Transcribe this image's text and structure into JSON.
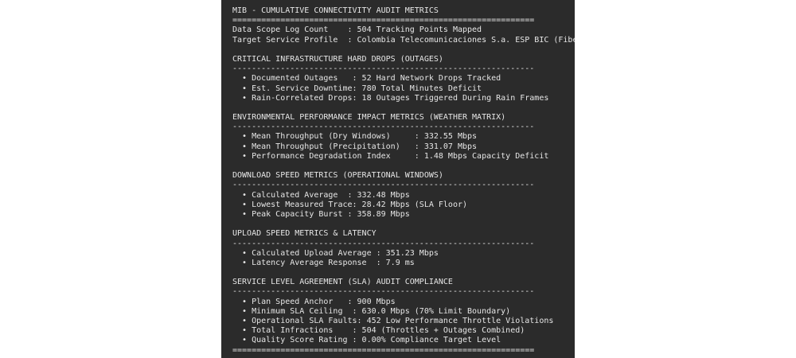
{
  "title": "MIB - CUMULATIVE CONNECTIVITY AUDIT METRICS",
  "rule_double": "===============================================================",
  "rule_single": "---------------------------------------------------------------",
  "header": {
    "scope": "Data Scope Log Count    : 504 Tracking Points Mapped",
    "profile": "Target Service Profile  : Colombia Telecomunicaciones S.a. ESP BIC (Fiber)"
  },
  "outages": {
    "heading": "CRITICAL INFRASTRUCTURE HARD DROPS (OUTAGES)",
    "items": [
      "  • Documented Outages   : 52 Hard Network Drops Tracked",
      "  • Est. Service Downtime: 780 Total Minutes Deficit",
      "  • Rain-Correlated Drops: 18 Outages Triggered During Rain Frames"
    ]
  },
  "weather": {
    "heading": "ENVIRONMENTAL PERFORMANCE IMPACT METRICS (WEATHER MATRIX)",
    "items": [
      "  • Mean Throughput (Dry Windows)     : 332.55 Mbps",
      "  • Mean Throughput (Precipitation)   : 331.07 Mbps",
      "  • Performance Degradation Index     : 1.48 Mbps Capacity Deficit"
    ]
  },
  "download": {
    "heading": "DOWNLOAD SPEED METRICS (OPERATIONAL WINDOWS)",
    "items": [
      "  • Calculated Average  : 332.48 Mbps",
      "  • Lowest Measured Trace: 28.42 Mbps (SLA Floor)",
      "  • Peak Capacity Burst : 358.89 Mbps"
    ]
  },
  "upload": {
    "heading": "UPLOAD SPEED METRICS & LATENCY",
    "items": [
      "  • Calculated Upload Average : 351.23 Mbps",
      "  • Latency Average Response  : 7.9 ms"
    ]
  },
  "sla": {
    "heading": "SERVICE LEVEL AGREEMENT (SLA) AUDIT COMPLIANCE",
    "items": [
      "  • Plan Speed Anchor   : 900 Mbps",
      "  • Minimum SLA Ceiling  : 630.0 Mbps (70% Limit Boundary)",
      "  • Operational SLA Faults: 452 Low Performance Throttle Violations",
      "  • Total Infractions    : 504 (Throttles + Outages Combined)",
      "  • Quality Score Rating : 0.00% Compliance Target Level"
    ]
  }
}
